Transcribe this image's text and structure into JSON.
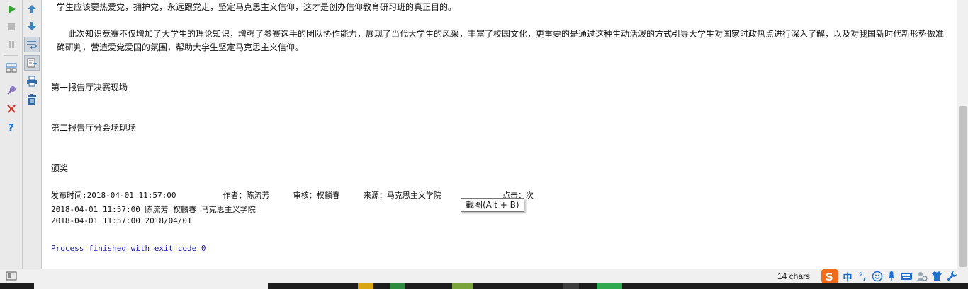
{
  "toolbar_left": {
    "run_icon": "play-icon",
    "stop_icon": "stop-icon",
    "pause_icon": "pause-icon",
    "layout_icon": "layout-icon",
    "pin_icon": "pin-icon",
    "close_icon": "close-icon",
    "help_icon": "help-icon"
  },
  "toolbar_right": {
    "up_icon": "arrow-up-icon",
    "down_icon": "arrow-down-icon",
    "wrap_icon": "soft-wrap-icon",
    "scroll_end_icon": "scroll-to-end-icon",
    "print_icon": "print-icon",
    "trash_icon": "trash-icon"
  },
  "output": {
    "para1": "学生应该要热爱党，拥护党，永远跟党走，坚定马克思主义信仰，这才是创办信仰教育研习班的真正目的。",
    "para2_line1": "此次知识竞赛不仅增加了大学生的理论知识，增强了参赛选手的团队协作能力，展现了当代大学生的风采，丰富了校园文化，更重要的是通过这种生动活泼的方式引导大学生对国家时政热点进行深入了解，以及对我国新时代新形势做准",
    "para2_line2": "确研判，营造爱党爱国的氛围，帮助大学生坚定马克思主义信仰。",
    "heading1": "第一报告厅决赛现场",
    "heading2": "第二报告厅分会场现场",
    "heading3": "颁奖",
    "meta_line": "发布时间:2018-04-01 11:57:00          作者：陈流芳     审核：权麟春     来源：马克思主义学院             点击：次",
    "result_line1": "2018-04-01 11:57:00 陈流芳 权麟春 马克思主义学院",
    "result_line2": "2018-04-01 11:57:00 2018/04/01",
    "exit_line": "Process finished with exit code 0"
  },
  "tooltip": "截图(Alt + B)",
  "statusbar": {
    "char_count": "14 chars",
    "ime_chinese": "中",
    "ime_punct": "°,"
  },
  "colors": {
    "run_green": "#3aa335",
    "close_red": "#d23c2e",
    "help_blue": "#2b79d0",
    "exit_blue": "#1b1bb5",
    "sogou_orange": "#f26a1b",
    "ime_blue": "#1e6fd0"
  }
}
